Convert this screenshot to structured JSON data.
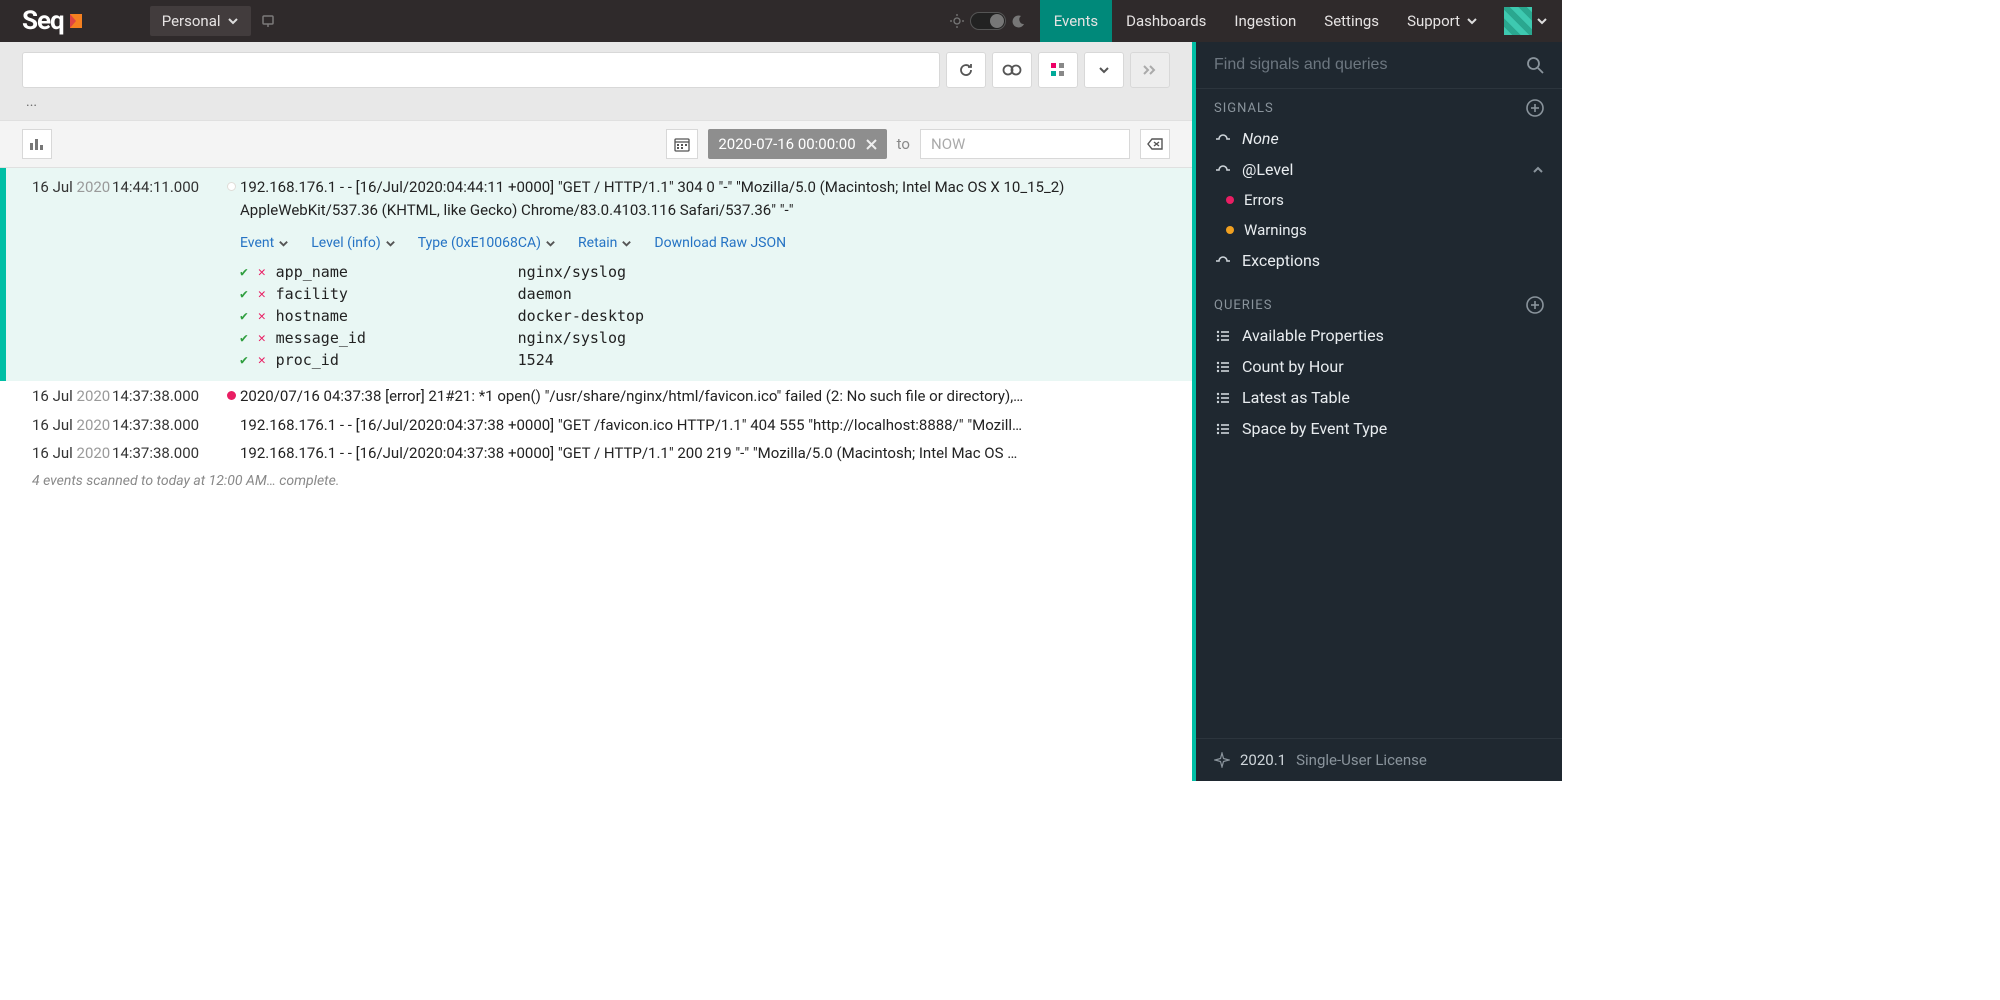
{
  "brand": "Seq",
  "workspace": {
    "label": "Personal"
  },
  "nav": {
    "events": "Events",
    "dashboards": "Dashboards",
    "ingestion": "Ingestion",
    "settings": "Settings",
    "support": "Support"
  },
  "query": {
    "value": "",
    "status": "..."
  },
  "range": {
    "from": "2020-07-16 00:00:00",
    "to_label": "to",
    "to_placeholder": "NOW"
  },
  "events": [
    {
      "date_day": "16 Jul",
      "date_year": "2020",
      "time": "14:44:11.000",
      "level_color": "white",
      "message": "192.168.176.1 - - [16/Jul/2020:04:44:11 +0000] \"GET / HTTP/1.1\" 304 0 \"-\" \"Mozilla/5.0 (Macintosh; Intel Mac OS X 10_15_2) AppleWebKit/537.36 (KHTML, like Gecko) Chrome/83.0.4103.116 Safari/537.36\" \"-\"",
      "expanded": true,
      "actions": {
        "event": "Event",
        "level": "Level (info)",
        "type": "Type (0xE10068CA)",
        "retain": "Retain",
        "download": "Download Raw JSON"
      },
      "props": [
        {
          "k": "app_name",
          "v": "nginx/syslog"
        },
        {
          "k": "facility",
          "v": "daemon"
        },
        {
          "k": "hostname",
          "v": "docker-desktop"
        },
        {
          "k": "message_id",
          "v": "nginx/syslog"
        },
        {
          "k": "proc_id",
          "v": "1524"
        }
      ]
    },
    {
      "date_day": "16 Jul",
      "date_year": "2020",
      "time": "14:37:38.000",
      "level_color": "red",
      "message": "2020/07/16 04:37:38 [error] 21#21: *1 open() \"/usr/share/nginx/html/favicon.ico\" failed (2: No such file or directory),…"
    },
    {
      "date_day": "16 Jul",
      "date_year": "2020",
      "time": "14:37:38.000",
      "level_color": "none",
      "message": "192.168.176.1 - - [16/Jul/2020:04:37:38 +0000] \"GET /favicon.ico HTTP/1.1\" 404 555 \"http://localhost:8888/\" \"Mozill…"
    },
    {
      "date_day": "16 Jul",
      "date_year": "2020",
      "time": "14:37:38.000",
      "level_color": "none",
      "message": "192.168.176.1 - - [16/Jul/2020:04:37:38 +0000] \"GET / HTTP/1.1\" 200 219 \"-\" \"Mozilla/5.0 (Macintosh; Intel Mac OS …"
    }
  ],
  "events_footer": "4 events scanned to today at 12:00 AM… complete.",
  "sidebar": {
    "search_placeholder": "Find signals and queries",
    "signals_header": "SIGNALS",
    "signals": {
      "none": "None",
      "level": "@Level",
      "level_children": {
        "errors": "Errors",
        "warnings": "Warnings"
      },
      "exceptions": "Exceptions"
    },
    "queries_header": "QUERIES",
    "queries": {
      "available_properties": "Available Properties",
      "count_by_hour": "Count by Hour",
      "latest_as_table": "Latest as Table",
      "space_by_event_type": "Space by Event Type"
    },
    "footer": {
      "version": "2020.1",
      "license": "Single-User License"
    }
  },
  "colors": {
    "errors_dot": "#e91e63",
    "warnings_dot": "#f0a020"
  }
}
